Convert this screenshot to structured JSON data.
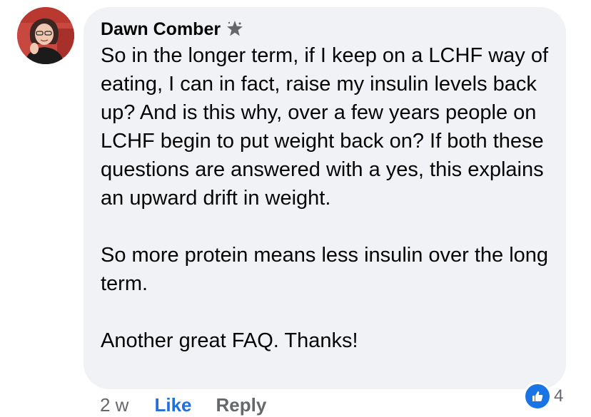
{
  "comment": {
    "author": "Dawn Comber",
    "author_badge_icon": "top-fan-star-icon",
    "paragraphs": [
      "So in the longer term, if I keep on a LCHF way of eating, I can in fact, raise my insulin levels back up? And is this why, over a few years people on LCHF begin to put weight back on? If both these questions are answered with a yes, this explains an upward drift in weight.",
      "So more protein means less insulin over the long term.",
      "Another great FAQ. Thanks!"
    ],
    "timestamp": "2 w",
    "like_label": "Like",
    "reply_label": "Reply",
    "reaction_icon": "thumbs-up-icon",
    "reaction_count": "4"
  },
  "colors": {
    "bubble_background": "#f0f2f5",
    "like_blue": "#216fdb",
    "reaction_blue": "#1b74e4",
    "secondary_text": "#65676b",
    "primary_text": "#050505"
  }
}
